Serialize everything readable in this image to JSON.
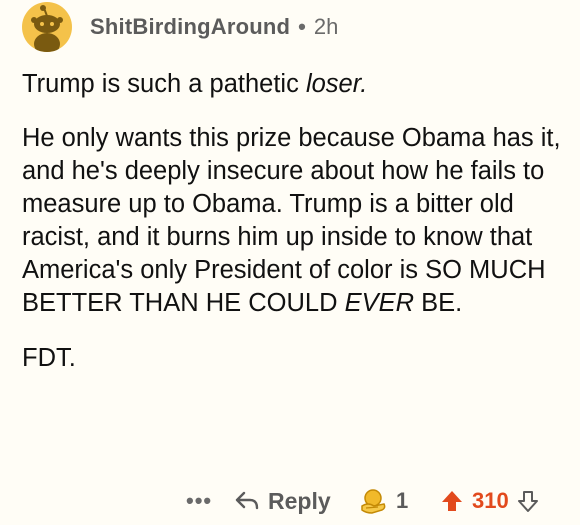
{
  "comment": {
    "author": "ShitBirdingAround",
    "separator": "•",
    "time_ago": "2h",
    "paragraph1": {
      "before": "Trump is such a pathetic ",
      "emphasis": "loser."
    },
    "paragraph2": {
      "before": "He only wants this prize because Obama has it, and he's deeply insecure about how he fails to measure up to Obama.  Trump is a bitter old racist, and it burns him up inside to know that America's only President of color is SO MUCH BETTER THAN HE COULD ",
      "emphasis": "EVER",
      "after": " BE."
    },
    "paragraph3": "FDT."
  },
  "actions": {
    "more_label": "•••",
    "reply_label": "Reply",
    "award_count": "1",
    "vote_score": "310",
    "icons": {
      "more": "more-icon",
      "reply": "reply-arrow-icon",
      "award": "award-hand-icon",
      "upvote": "upvote-icon",
      "downvote": "downvote-icon"
    }
  },
  "colors": {
    "background": "#fffdf6",
    "avatar": "#f4c24a",
    "upvote": "#e24a1d",
    "muted": "#5b5b5b"
  }
}
